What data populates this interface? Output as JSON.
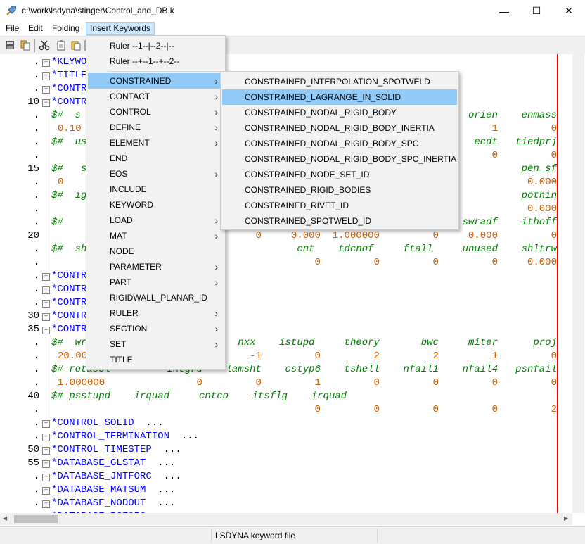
{
  "window": {
    "title": "c:\\work\\lsdyna\\stinger\\Control_and_DB.k",
    "minimize": "—",
    "maximize": "☐",
    "close": "✕",
    "icon": "rocket-icon"
  },
  "menubar": {
    "items": [
      "File",
      "Edit",
      "Folding",
      "Insert Keywords"
    ],
    "active": "Insert Keywords"
  },
  "toolbar": {
    "icons": [
      "save-icon",
      "copy-icon",
      "cut-icon",
      "clipboard-icon",
      "paste-icon",
      "page-icon"
    ]
  },
  "editor": {
    "gutter": [
      ".",
      ".",
      ".",
      "10",
      ".",
      ".",
      ".",
      ".",
      "15",
      ".",
      ".",
      ".",
      ".",
      "20",
      ".",
      ".",
      ".",
      ".",
      ".",
      "30",
      "35",
      ".",
      ".",
      ".",
      ".",
      "40",
      ".",
      ".",
      ".",
      "50",
      "55",
      ".",
      ".",
      ".",
      "."
    ],
    "keyword_lines": [
      {
        "text": "*KEYWO",
        "suffix": ""
      },
      {
        "text": "*TITLE",
        "suffix": ""
      },
      {
        "text": "*CONTR",
        "suffix": ""
      },
      {
        "text": "*CONTR",
        "suffix": ""
      },
      {
        "text": "*CONTR",
        "suffix": ""
      },
      {
        "text": "*CONTR",
        "suffix": ""
      },
      {
        "text": "*CONTR",
        "suffix": ""
      },
      {
        "text": "*CONTR",
        "suffix": ""
      },
      {
        "text": "*CONTR",
        "suffix": ""
      },
      {
        "text": "*CONTROL_SOLID",
        "suffix": "  ..."
      },
      {
        "text": "*CONTROL_TERMINATION",
        "suffix": "  ..."
      },
      {
        "text": "*CONTROL_TIMESTEP",
        "suffix": "  ..."
      },
      {
        "text": "*DATABASE_GLSTAT",
        "suffix": "  ..."
      },
      {
        "text": "*DATABASE_JNTFORC",
        "suffix": "  ..."
      },
      {
        "text": "*DATABASE_MATSUM",
        "suffix": "  ..."
      },
      {
        "text": "*DATABASE_NODOUT",
        "suffix": "  ..."
      },
      {
        "text": "*DATABASE_RCFORC",
        "suffix": ""
      }
    ],
    "comment_lines": [
      {
        "line": "$#  s",
        "right": "orien    enmass"
      },
      {
        "line": "$#  us",
        "right": "ecdt   tiedprj"
      },
      {
        "line": "$#   s",
        "right": "pen_sf"
      },
      {
        "line": "$#  ig",
        "right": "pothin"
      },
      {
        "line": "$#",
        "right": "swradf    ithoff"
      },
      {
        "line": "$#  sh",
        "right": "cnt    tdcnof     ftall     unused    shltrw"
      },
      {
        "line": "$#  wr",
        "right": "nxx    istupd     theory       bwc     miter      proj"
      },
      {
        "line": "$# rotascl",
        "right": "intgrd    lamsht    cstyp6    tshell    nfail1    nfail4   psnfail"
      },
      {
        "line": "$# psstupd    irquad     cntco    itsflg    irquad",
        "right": ""
      }
    ],
    "value_lines": [
      {
        "left": "0.10",
        "right": "1         0"
      },
      {
        "left": "",
        "right": "0         0"
      },
      {
        "left": "0",
        "right": "0.000"
      },
      {
        "left": "",
        "right": "0.000"
      },
      {
        "left": "",
        "right": "0     0.000  1.000000         0     0.000         0"
      },
      {
        "left": "",
        "right": "0         0         0         0     0.000"
      },
      {
        "left": "20.00",
        "right": "-1         0         2         2         1         0"
      },
      {
        "left": "1.000000",
        "right": "0         0         1         0         0         0         0"
      },
      {
        "left": "",
        "right": "0         0         0         0         2"
      }
    ]
  },
  "insert_menu": {
    "items": [
      {
        "label": "Ruler --1--|--2--|--",
        "arrow": false
      },
      {
        "label": "Ruler --+--1--+--2--",
        "arrow": false
      },
      {
        "label": "CONSTRAINED",
        "arrow": true,
        "highlighted": true
      },
      {
        "label": "CONTACT",
        "arrow": true
      },
      {
        "label": "CONTROL",
        "arrow": true
      },
      {
        "label": "DEFINE",
        "arrow": true
      },
      {
        "label": "ELEMENT",
        "arrow": true
      },
      {
        "label": "END",
        "arrow": false
      },
      {
        "label": "EOS",
        "arrow": true
      },
      {
        "label": "INCLUDE",
        "arrow": false
      },
      {
        "label": "KEYWORD",
        "arrow": false
      },
      {
        "label": "LOAD",
        "arrow": true
      },
      {
        "label": "MAT",
        "arrow": true
      },
      {
        "label": "NODE",
        "arrow": false
      },
      {
        "label": "PARAMETER",
        "arrow": true
      },
      {
        "label": "PART",
        "arrow": true
      },
      {
        "label": "RIGIDWALL_PLANAR_ID",
        "arrow": false
      },
      {
        "label": "RULER",
        "arrow": true
      },
      {
        "label": "SECTION",
        "arrow": true
      },
      {
        "label": "SET",
        "arrow": true
      },
      {
        "label": "TITLE",
        "arrow": false
      }
    ]
  },
  "constrained_submenu": {
    "items": [
      {
        "label": "CONSTRAINED_INTERPOLATION_SPOTWELD"
      },
      {
        "label": "CONSTRAINED_LAGRANGE_IN_SOLID",
        "highlighted": true
      },
      {
        "label": "CONSTRAINED_NODAL_RIGID_BODY"
      },
      {
        "label": "CONSTRAINED_NODAL_RIGID_BODY_INERTIA"
      },
      {
        "label": "CONSTRAINED_NODAL_RIGID_BODY_SPC"
      },
      {
        "label": "CONSTRAINED_NODAL_RIGID_BODY_SPC_INERTIA"
      },
      {
        "label": "CONSTRAINED_NODE_SET_ID"
      },
      {
        "label": "CONSTRAINED_RIGID_BODIES"
      },
      {
        "label": "CONSTRAINED_RIVET_ID"
      },
      {
        "label": "CONSTRAINED_SPOTWELD_ID"
      }
    ]
  },
  "statusbar": {
    "text": "LSDYNA keyword file"
  },
  "colors": {
    "keyword": "#0000ff",
    "comment": "#008000",
    "number": "#d06000",
    "menu_highlight": "#91c9f7",
    "margin": "#ff0000"
  }
}
